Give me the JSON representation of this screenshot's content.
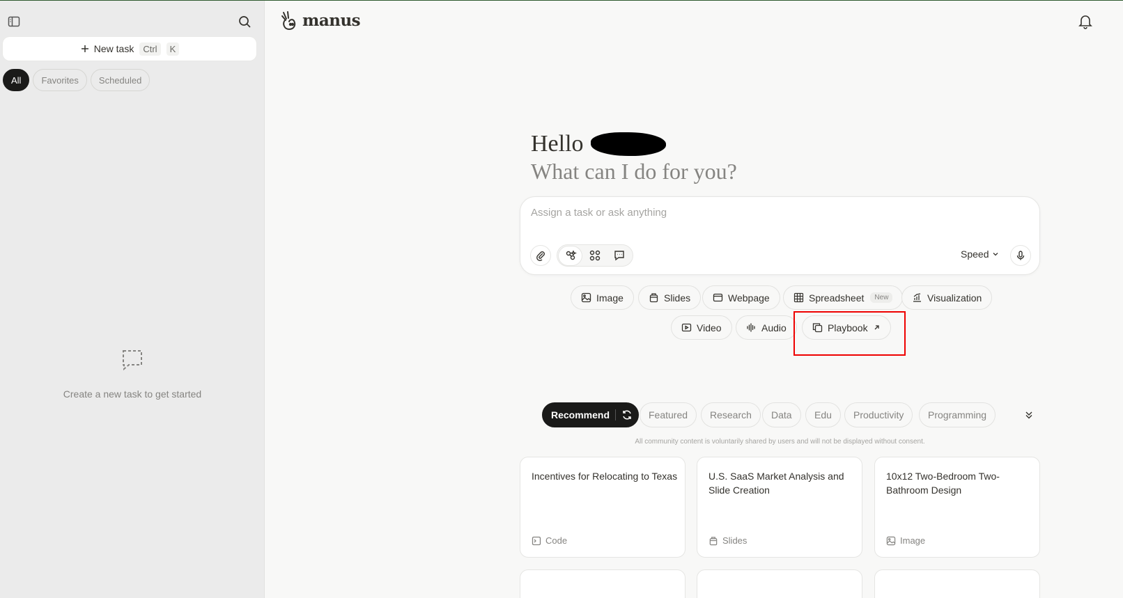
{
  "sidebar": {
    "new_task": "New task",
    "shortcut_ctrl": "Ctrl",
    "shortcut_k": "K",
    "filters": [
      "All",
      "Favorites",
      "Scheduled"
    ],
    "empty_text": "Create a new task to get started"
  },
  "header": {
    "logo_text": "manus"
  },
  "greeting": {
    "hello": "Hello",
    "question": "What can I do for you?"
  },
  "input": {
    "placeholder": "Assign a task or ask anything",
    "mode_label": "Speed"
  },
  "chips": {
    "image": "Image",
    "slides": "Slides",
    "webpage": "Webpage",
    "spreadsheet": "Spreadsheet",
    "spreadsheet_badge": "New",
    "visualization": "Visualization",
    "video": "Video",
    "audio": "Audio",
    "playbook": "Playbook"
  },
  "categories": [
    "Recommend",
    "Featured",
    "Research",
    "Data",
    "Edu",
    "Productivity",
    "Programming"
  ],
  "disclaimer": "All community content is voluntarily shared by users and will not be displayed without consent.",
  "cards": [
    {
      "title": "Incentives for Relocating to Texas",
      "tag": "Code"
    },
    {
      "title": "U.S. SaaS Market Analysis and Slide Creation",
      "tag": "Slides"
    },
    {
      "title": "10x12 Two-Bedroom Two-Bathroom Design",
      "tag": "Image"
    }
  ],
  "colors": {
    "accent_dark": "#1a1a19",
    "highlight_box": "#e00000",
    "sidebar_bg": "#ebebeb",
    "page_bg": "#f8f8f7"
  }
}
